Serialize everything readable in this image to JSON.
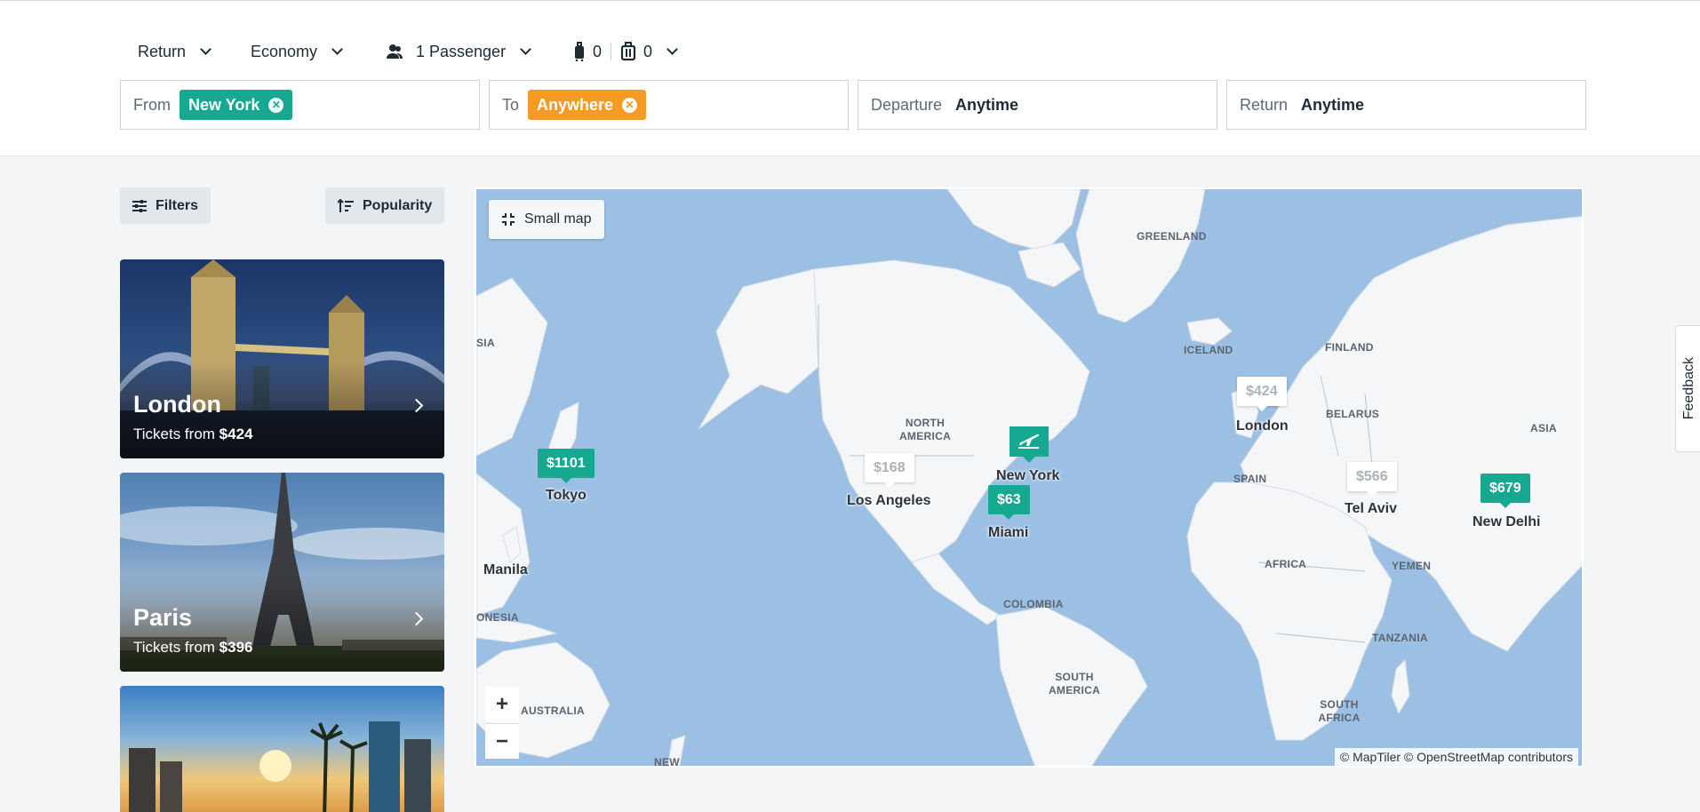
{
  "options": {
    "trip_type": "Return",
    "cabin": "Economy",
    "passengers": "1 Passenger",
    "cabin_bags": "0",
    "checked_bags": "0"
  },
  "search": {
    "from_label": "From",
    "from_value": "New York",
    "to_label": "To",
    "to_value": "Anywhere",
    "departure_label": "Departure",
    "departure_value": "Anytime",
    "return_label": "Return",
    "return_value": "Anytime"
  },
  "list_controls": {
    "filters": "Filters",
    "sort": "Popularity"
  },
  "destinations": [
    {
      "city": "London",
      "prefix": "Tickets from ",
      "price": "$424"
    },
    {
      "city": "Paris",
      "prefix": "Tickets from ",
      "price": "$396"
    },
    {
      "city": "",
      "prefix": "",
      "price": ""
    }
  ],
  "map": {
    "small_map": "Small map",
    "zoom_in": "+",
    "zoom_out": "−",
    "attribution": "© MapTiler © OpenStreetMap contributors",
    "regions": [
      "GREENLAND",
      "ICELAND",
      "FINLAND",
      "BELARUS",
      "ASIA",
      "SIA",
      "NORTH AMERICA",
      "SPAIN",
      "AFRICA",
      "YEMEN",
      "TANZANIA",
      "SOUTH AFRICA",
      "COLOMBIA",
      "SOUTH AMERICA",
      "ONESIA",
      "AUSTRALIA",
      "NEW"
    ],
    "places": [
      "Tokyo",
      "Manila",
      "Los Angeles",
      "New York",
      "Miami",
      "London",
      "Tel Aviv",
      "New Delhi"
    ],
    "prices": [
      "$1101",
      "$168",
      "$63",
      "$424",
      "$566",
      "$679"
    ]
  },
  "feedback": "Feedback",
  "colors": {
    "teal": "#17a892",
    "orange": "#f59a23",
    "ocean": "#9cc0e4",
    "land": "#f4f6f8"
  }
}
